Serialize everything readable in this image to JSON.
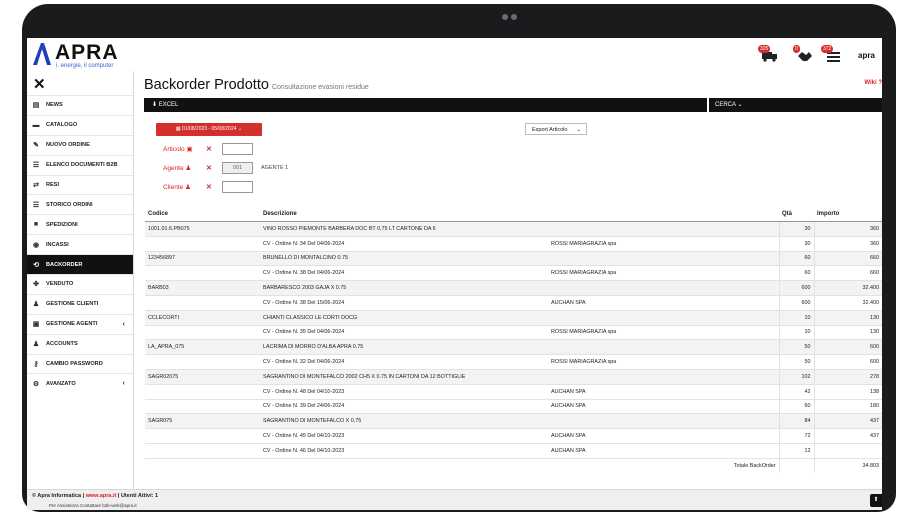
{
  "app": {
    "logo_name": "APRA",
    "logo_sub": "i. energie, il computer",
    "user_label": "apra",
    "badges": [
      "325",
      "0",
      "372"
    ],
    "wiki_label": "Wiki ?"
  },
  "sidebar": {
    "items": [
      {
        "label": "NEWS",
        "icon": "news-icon"
      },
      {
        "label": "CATALOGO",
        "icon": "catalog-icon"
      },
      {
        "label": "NUOVO ORDINE",
        "icon": "pencil-icon"
      },
      {
        "label": "ELENCO DOCUMENTI B2B",
        "icon": "list-icon"
      },
      {
        "label": "RESI",
        "icon": "exchange-icon"
      },
      {
        "label": "STORICO ORDINI",
        "icon": "list-icon"
      },
      {
        "label": "SPEDIZIONI",
        "icon": "truck-icon"
      },
      {
        "label": "INCASSI",
        "icon": "cash-icon"
      },
      {
        "label": "BACKORDER",
        "icon": "backorder-icon"
      },
      {
        "label": "VENDUTO",
        "icon": "handshake-icon"
      },
      {
        "label": "GESTIONE CLIENTI",
        "icon": "user-icon"
      },
      {
        "label": "GESTIONE AGENTI",
        "icon": "briefcase-icon"
      },
      {
        "label": "ACCOUNTS",
        "icon": "users-icon"
      },
      {
        "label": "CAMBIO PASSWORD",
        "icon": "key-icon"
      },
      {
        "label": "AVANZATO",
        "icon": "cogs-icon"
      }
    ]
  },
  "page": {
    "title": "Backorder Prodotto",
    "subtitle": "Consultazione evasioni residue"
  },
  "toolbar": {
    "excel_label": "EXCEL",
    "cerca_label": "CERCA"
  },
  "filters": {
    "date_range": "01/08/2023 - 05/08/2024",
    "export_select": "Export Articolo",
    "articolo_label": "Articolo",
    "agente_label": "Agente",
    "agente_value": "001",
    "agente_name": "AGENTE 1",
    "cliente_label": "Cliente"
  },
  "table": {
    "headers": [
      "Codice",
      "Descrizione",
      "",
      "Qtà",
      "Importo"
    ],
    "rows": [
      {
        "type": "main",
        "code": "1001.01.6.PB075",
        "desc": "VINO ROSSO PIEMONTE BARBERA DOC BT 0,75 LT CARTONE DA 6",
        "client": "",
        "qty": "30",
        "imp": "360"
      },
      {
        "type": "sub",
        "code": "",
        "desc": "CV - Ordine N. 34 Del 04/06-2024",
        "client": "ROSSI MARIAGRAZIA spa",
        "qty": "30",
        "imp": "360"
      },
      {
        "type": "main",
        "code": "123456897",
        "desc": "BRUNELLO DI MONTALCINO 0.75",
        "client": "",
        "qty": "60",
        "imp": "660"
      },
      {
        "type": "sub",
        "code": "",
        "desc": "CV - Ordine N. 38 Del 04/06-2024",
        "client": "ROSSI MARIAGRAZIA spa",
        "qty": "60",
        "imp": "660"
      },
      {
        "type": "main",
        "code": "BARB03",
        "desc": "BARBARESCO 2003 GAJA X 0.75",
        "client": "",
        "qty": "600",
        "imp": "32.400"
      },
      {
        "type": "sub",
        "code": "",
        "desc": "CV - Ordine N. 38 Del 15/06-2024",
        "client": "AUCHAN SPA",
        "qty": "600",
        "imp": "32.400"
      },
      {
        "type": "main",
        "code": "CCLECORTI",
        "desc": "CHIANTI CLASSICO LE CORTI DOCG",
        "client": "",
        "qty": "10",
        "imp": "130"
      },
      {
        "type": "sub",
        "code": "",
        "desc": "CV - Ordine N. 35 Del 04/06-2024",
        "client": "ROSSI MARIAGRAZIA spa",
        "qty": "10",
        "imp": "130"
      },
      {
        "type": "main",
        "code": "LA_APRA_075",
        "desc": "LACRIMA DI MORRO D'ALBA APRA 0.75",
        "client": "",
        "qty": "50",
        "imp": "600"
      },
      {
        "type": "sub",
        "code": "",
        "desc": "CV - Ordine N. 32 Del 04/06-2024",
        "client": "ROSSI MARIAGRAZIA spa",
        "qty": "50",
        "imp": "600"
      },
      {
        "type": "main",
        "code": "SAGR02075",
        "desc": "SAGRANTINO DI MONTEFALCO 2002 CH5 X 0.75 IN CARTONI DA 12 BOTTIGLIE",
        "client": "",
        "qty": "102",
        "imp": "278"
      },
      {
        "type": "sub",
        "code": "",
        "desc": "CV - Ordine N. 48 Del 04/10-2023",
        "client": "AUCHAN SPA",
        "qty": "42",
        "imp": "138"
      },
      {
        "type": "sub",
        "code": "",
        "desc": "CV - Ordine N. 39 Del 24/06-2024",
        "client": "AUCHAN SPA",
        "qty": "60",
        "imp": "180"
      },
      {
        "type": "main",
        "code": "SAGR075",
        "desc": "SAGRANTINO DI MONTEFALCO X 0,75",
        "client": "",
        "qty": "84",
        "imp": "437"
      },
      {
        "type": "sub",
        "code": "",
        "desc": "CV - Ordine N. 45 Del 04/10-2023",
        "client": "AUCHAN SPA",
        "qty": "72",
        "imp": "437"
      },
      {
        "type": "sub",
        "code": "",
        "desc": "CV - Ordine N. 46 Del 04/10-2023",
        "client": "AUCHAN SPA",
        "qty": "12",
        "imp": ""
      },
      {
        "type": "total",
        "code": "",
        "desc": "",
        "client": "Totale BackOrder",
        "qty": "",
        "imp": "34.803"
      }
    ]
  },
  "footer": {
    "copyright": "© Apra Informatica |",
    "site": "www.apra.it",
    "users": "| Utenti Attivi: 1",
    "assist": "Per Assistenza Contattare b2b-web@apra.it",
    "scroll_top": "⬆"
  }
}
